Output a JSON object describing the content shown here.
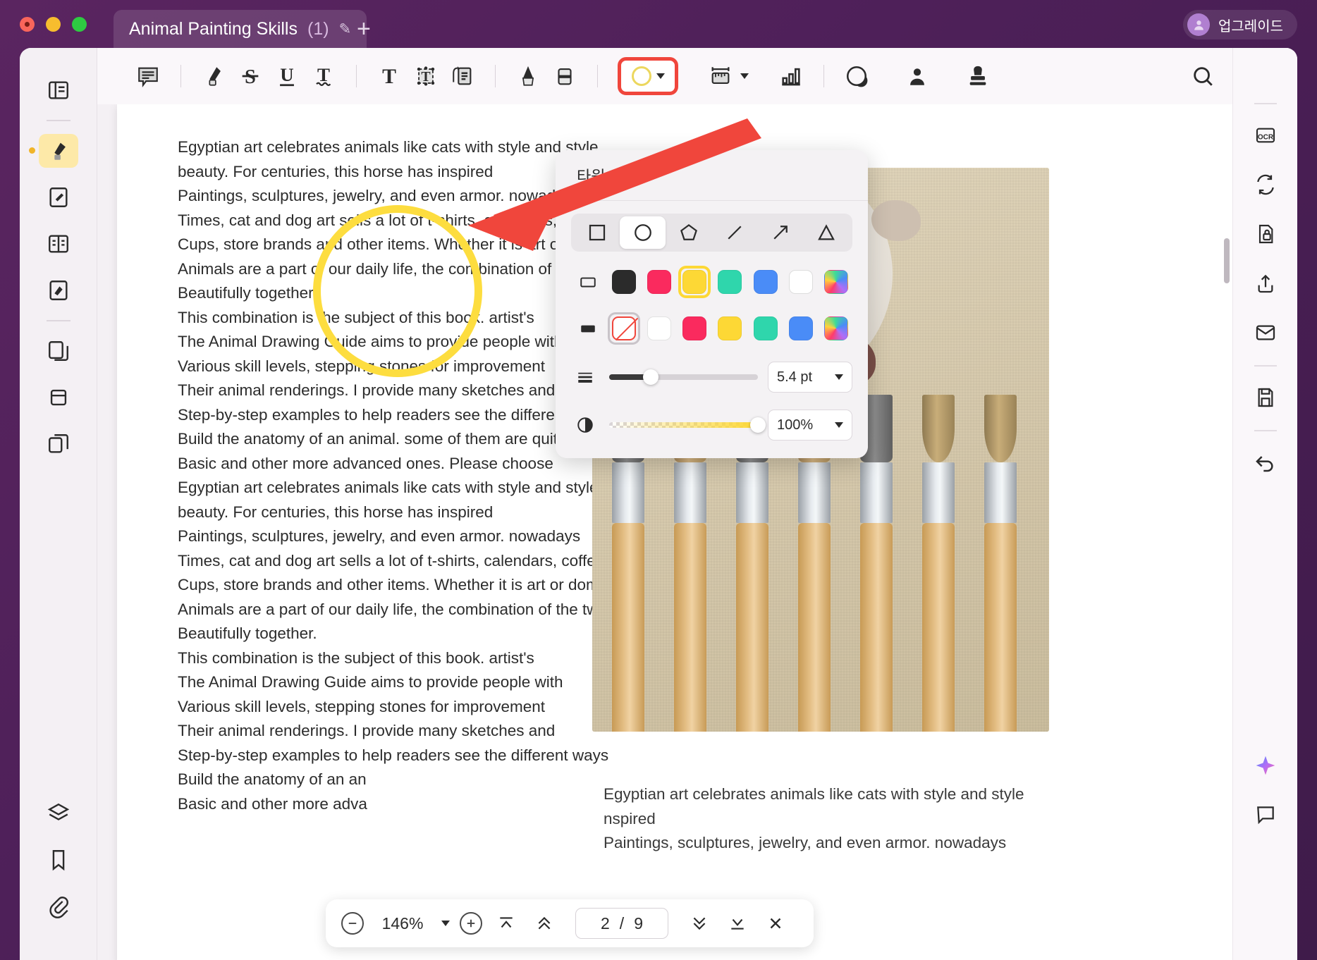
{
  "window": {
    "tab_title": "Animal Painting Skills",
    "tab_count": "(1)",
    "new_tab_label": "+",
    "upgrade_label": "업그레이드"
  },
  "toolbar": {
    "items": [
      {
        "name": "comment-icon",
        "label": "Comment"
      },
      {
        "name": "highlighter-icon",
        "label": "Highlight"
      },
      {
        "name": "strikethrough-icon",
        "label": "Strikethrough"
      },
      {
        "name": "underline-icon",
        "label": "Underline"
      },
      {
        "name": "squiggly-underline-icon",
        "label": "Squiggly"
      },
      {
        "name": "text-icon",
        "label": "Text"
      },
      {
        "name": "text-box-icon",
        "label": "Text Box"
      },
      {
        "name": "note-icon",
        "label": "Note"
      },
      {
        "name": "pencil-icon",
        "label": "Pencil"
      },
      {
        "name": "eraser-icon",
        "label": "Eraser"
      },
      {
        "name": "shape-ellipse-icon",
        "label": "Shape"
      },
      {
        "name": "measure-ruler-icon",
        "label": "Measure"
      },
      {
        "name": "chart-icon",
        "label": "Chart"
      },
      {
        "name": "sticker-icon",
        "label": "Sticker"
      },
      {
        "name": "signature-icon",
        "label": "Signature"
      },
      {
        "name": "stamp-icon",
        "label": "Stamp"
      }
    ],
    "search_icon": "search-icon"
  },
  "left_rail": {
    "items": [
      {
        "name": "sidebar-item-thumbnails",
        "icon": "panel-icon"
      },
      {
        "name": "sidebar-item-highlight",
        "icon": "highlighter-icon",
        "active": true
      },
      {
        "name": "sidebar-item-edit",
        "icon": "edit-page-icon"
      },
      {
        "name": "sidebar-item-read",
        "icon": "reader-icon"
      },
      {
        "name": "sidebar-item-annotate",
        "icon": "annotate-icon"
      },
      {
        "name": "sidebar-item-pages",
        "icon": "pages-icon"
      },
      {
        "name": "sidebar-item-crop",
        "icon": "crop-icon"
      },
      {
        "name": "sidebar-item-organize",
        "icon": "organize-icon"
      },
      {
        "name": "sidebar-item-layers",
        "icon": "layers-icon"
      },
      {
        "name": "sidebar-item-bookmarks",
        "icon": "bookmark-icon"
      },
      {
        "name": "sidebar-item-attachments",
        "icon": "paperclip-icon"
      }
    ]
  },
  "right_rail": {
    "items": [
      {
        "name": "ocr-button",
        "icon": "ocr-icon"
      },
      {
        "name": "convert-button",
        "icon": "convert-icon"
      },
      {
        "name": "protect-button",
        "icon": "lock-page-icon"
      },
      {
        "name": "share-button",
        "icon": "share-icon"
      },
      {
        "name": "email-button",
        "icon": "envelope-icon"
      },
      {
        "name": "save-button",
        "icon": "save-icon"
      },
      {
        "name": "undo-button",
        "icon": "undo-icon"
      },
      {
        "name": "ai-button",
        "icon": "ai-sparkle-icon"
      },
      {
        "name": "comments-button",
        "icon": "comment-panel-icon"
      }
    ]
  },
  "shape_popup": {
    "title": "타원",
    "shapes": [
      {
        "name": "shape-square",
        "selected": false
      },
      {
        "name": "shape-circle",
        "selected": true
      },
      {
        "name": "shape-pentagon",
        "selected": false
      },
      {
        "name": "shape-line",
        "selected": false
      },
      {
        "name": "shape-arrow",
        "selected": false
      },
      {
        "name": "shape-triangle",
        "selected": false
      }
    ],
    "stroke_row": {
      "lead_icon": "stroke-outline-icon",
      "swatches": [
        {
          "name": "stroke-black",
          "color": "#2b2b2b",
          "selected": false
        },
        {
          "name": "stroke-pink",
          "color": "#fa2a5e",
          "selected": false
        },
        {
          "name": "stroke-yellow",
          "color": "#fdd835",
          "selected": true
        },
        {
          "name": "stroke-teal",
          "color": "#2fd6ac",
          "selected": false
        },
        {
          "name": "stroke-blue",
          "color": "#4a8cf7",
          "selected": false
        },
        {
          "name": "stroke-white",
          "color": "#ffffff",
          "selected": false
        },
        {
          "name": "stroke-custom",
          "color": "rainbow",
          "selected": false
        }
      ]
    },
    "fill_row": {
      "lead_icon": "fill-solid-icon",
      "swatches": [
        {
          "name": "fill-none",
          "color": "none",
          "selected": true
        },
        {
          "name": "fill-white",
          "color": "#ffffff",
          "selected": false
        },
        {
          "name": "fill-pink",
          "color": "#fa2a5e",
          "selected": false
        },
        {
          "name": "fill-yellow",
          "color": "#fdd835",
          "selected": false
        },
        {
          "name": "fill-teal",
          "color": "#2fd6ac",
          "selected": false
        },
        {
          "name": "fill-blue",
          "color": "#4a8cf7",
          "selected": false
        },
        {
          "name": "fill-custom",
          "color": "rainbow",
          "selected": false
        }
      ]
    },
    "thickness": {
      "icon": "line-weight-icon",
      "value": "5.4 pt",
      "percent": 28
    },
    "opacity": {
      "icon": "opacity-icon",
      "value": "100%",
      "percent": 100
    }
  },
  "document": {
    "column_one": [
      "Egyptian art celebrates animals like cats with style and style",
      "beauty. For centuries, this horse has inspired",
      "Paintings, sculptures, jewelry, and even armor. nowadays",
      "Times, cat and dog art sells a lot of t-shirts, calendars, coffee",
      "Cups, store brands and other items. Whether it is art or domestic",
      "Animals are a part of our daily life, the combination of the two",
      "Beautifully together.",
      "This combination is the subject of this book. artist's",
      "The Animal Drawing Guide aims to provide people with",
      "Various skill levels, stepping stones for improvement",
      "Their animal renderings. I provide many sketches and",
      "Step-by-step examples to help readers see the different ways",
      "Build the anatomy of an animal. some of them are quite",
      "Basic and other more advanced ones. Please choose",
      "Egyptian art celebrates animals like cats with style and style",
      "beauty. For centuries, this horse has inspired",
      "Paintings, sculptures, jewelry, and even armor. nowadays",
      "Times, cat and dog art sells a lot of t-shirts, calendars, coffee",
      "Cups, store brands and other items. Whether it is art or domestic",
      "Animals are a part of our daily life, the combination of the two",
      "Beautifully together.",
      "This combination is the subject of this book. artist's",
      "The Animal Drawing Guide aims to provide people with",
      "Various skill levels, stepping stones for improvement",
      "Their animal renderings. I provide many sketches and",
      "Step-by-step examples to help readers see the different ways",
      "Build the anatomy of an an",
      "Basic and other more adva"
    ],
    "column_two": [
      "Egyptian art celebrates animals like cats with style and style",
      "nspired",
      "Paintings, sculptures, jewelry, and even armor. nowadays"
    ]
  },
  "page_bar": {
    "zoom_out": "−",
    "zoom_level": "146%",
    "zoom_in": "+",
    "current_page": "2",
    "separator": "/",
    "total_pages": "9",
    "buttons": [
      {
        "name": "first-page-button",
        "icon": "chevron-up-bar-icon"
      },
      {
        "name": "previous-page-button",
        "icon": "double-chevron-up-icon"
      },
      {
        "name": "next-page-button",
        "icon": "double-chevron-down-icon"
      },
      {
        "name": "last-page-button",
        "icon": "chevron-down-bar-icon"
      },
      {
        "name": "close-page-bar-button",
        "icon": "close-icon"
      }
    ]
  },
  "annotation": {
    "oval_color": "#fddd3f",
    "arrow_color": "#f0463c"
  }
}
